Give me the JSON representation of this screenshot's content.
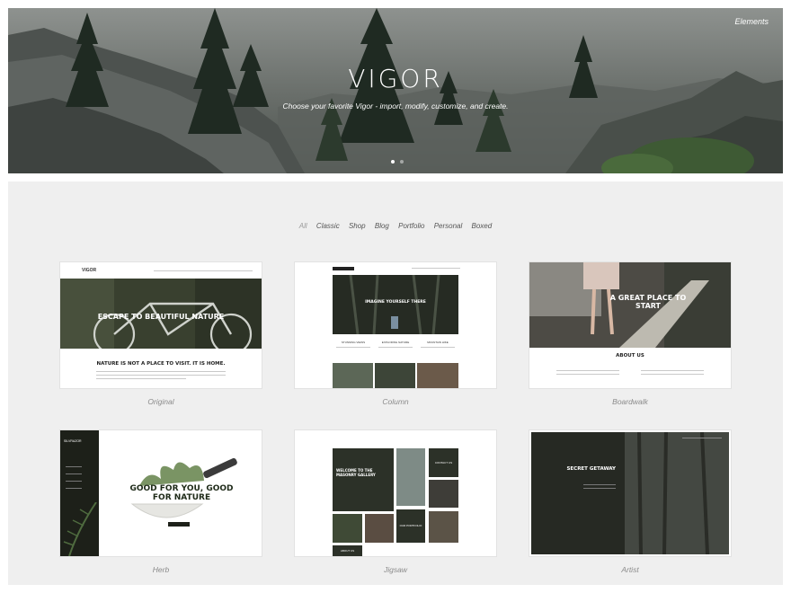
{
  "hero": {
    "top_link": "Elements",
    "brand": "VIGOR",
    "tagline": "Choose your favorite Vigor - import, modify, customize, and create."
  },
  "filters": [
    "All",
    "Classic",
    "Shop",
    "Blog",
    "Portfolio",
    "Personal",
    "Boxed"
  ],
  "demos": [
    {
      "name": "Original",
      "headline": "ESCAPE TO BEAUTIFUL NATURE",
      "sub": "NATURE IS NOT A PLACE TO VISIT. IT IS HOME.",
      "logo": "VIGOR"
    },
    {
      "name": "Column",
      "headline": "IMAGINE YOURSELF THERE",
      "cols": [
        "STUNNING VIEWS",
        "EXPLORING NATURE",
        "MOUNTAIN HIKE"
      ]
    },
    {
      "name": "Boardwalk",
      "headline": "A GREAT PLACE TO START",
      "sub": "ABOUT US"
    },
    {
      "name": "Herb",
      "headline": "GOOD FOR YOU, GOOD FOR NATURE",
      "logo": "SILVRAZOR"
    },
    {
      "name": "Jigsaw",
      "headline": "WELCOME TO THE MASONRY GALLERY",
      "tiles": [
        "CONTACT US",
        "OUR PORTFOLIO",
        "ABOUT US"
      ]
    },
    {
      "name": "Artist",
      "headline": "SECRET GETAWAY"
    }
  ],
  "colors": {
    "panel_bg": "#efefef",
    "label_gray": "#8a8a8a",
    "dark_green": "#2c3128"
  }
}
